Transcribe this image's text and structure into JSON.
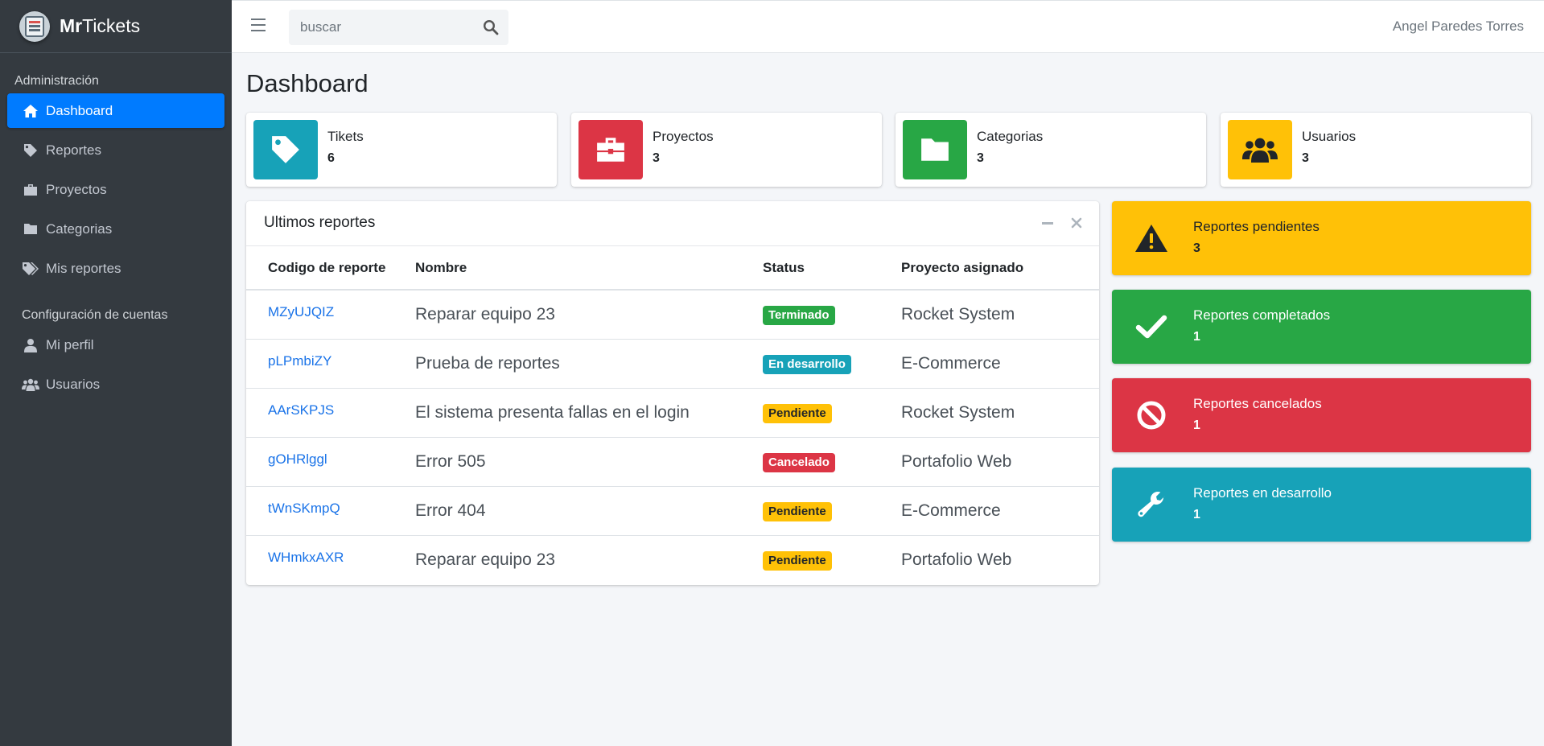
{
  "colors": {
    "primary": "#007bff",
    "info": "#17a2b8",
    "danger": "#dc3545",
    "success": "#28a745",
    "warning": "#ffc107",
    "sidebar": "#343a40"
  },
  "brand": {
    "bold": "Mr",
    "light": "Tickets",
    "logo_icon": "ticket-logo-icon"
  },
  "sidebar": {
    "section1": "Administración",
    "items1": [
      {
        "label": "Dashboard",
        "icon": "home-icon",
        "active": true
      },
      {
        "label": "Reportes",
        "icon": "tag-icon"
      },
      {
        "label": "Proyectos",
        "icon": "briefcase-icon"
      },
      {
        "label": "Categorias",
        "icon": "folder-icon"
      },
      {
        "label": "Mis reportes",
        "icon": "tags-icon"
      }
    ],
    "section2": "Configuración de cuentas",
    "items2": [
      {
        "label": "Mi perfil",
        "icon": "user-icon"
      },
      {
        "label": "Usuarios",
        "icon": "users-icon"
      }
    ]
  },
  "topbar": {
    "search_placeholder": "buscar",
    "user_name": "Angel Paredes Torres"
  },
  "page": {
    "title": "Dashboard"
  },
  "info_boxes": [
    {
      "label": "Tikets",
      "value": "6",
      "icon": "tag-icon",
      "color": "#17a2b8"
    },
    {
      "label": "Proyectos",
      "value": "3",
      "icon": "briefcase-icon",
      "color": "#dc3545"
    },
    {
      "label": "Categorias",
      "value": "3",
      "icon": "folder-icon",
      "color": "#28a745"
    },
    {
      "label": "Usuarios",
      "value": "3",
      "icon": "users-icon",
      "color": "#ffc107"
    }
  ],
  "reports_card": {
    "title": "Ultimos reportes",
    "columns": [
      "Codigo de reporte",
      "Nombre",
      "Status",
      "Proyecto asignado"
    ],
    "rows": [
      {
        "code": "MZyUJQIZ",
        "name": "Reparar equipo 23",
        "status": "Terminado",
        "status_color": "#28a745",
        "project": "Rocket System"
      },
      {
        "code": "pLPmbiZY",
        "name": "Prueba de reportes",
        "status": "En desarrollo",
        "status_color": "#17a2b8",
        "project": "E-Commerce"
      },
      {
        "code": "AArSKPJS",
        "name": "El sistema presenta fallas en el login",
        "status": "Pendiente",
        "status_color": "#ffc107",
        "project": "Rocket System"
      },
      {
        "code": "gOHRlggl",
        "name": "Error 505",
        "status": "Cancelado",
        "status_color": "#dc3545",
        "project": "Portafolio Web"
      },
      {
        "code": "tWnSKmpQ",
        "name": "Error 404",
        "status": "Pendiente",
        "status_color": "#ffc107",
        "project": "E-Commerce"
      },
      {
        "code": "WHmkxAXR",
        "name": "Reparar equipo 23",
        "status": "Pendiente",
        "status_color": "#ffc107",
        "project": "Portafolio Web"
      }
    ]
  },
  "summary_boxes": [
    {
      "label": "Reportes pendientes",
      "value": "3",
      "icon": "warning-icon",
      "color": "#ffc107"
    },
    {
      "label": "Reportes completados",
      "value": "1",
      "icon": "check-icon",
      "color": "#28a745"
    },
    {
      "label": "Reportes cancelados",
      "value": "1",
      "icon": "ban-icon",
      "color": "#dc3545"
    },
    {
      "label": "Reportes en desarrollo",
      "value": "1",
      "icon": "wrench-icon",
      "color": "#17a2b8"
    }
  ]
}
